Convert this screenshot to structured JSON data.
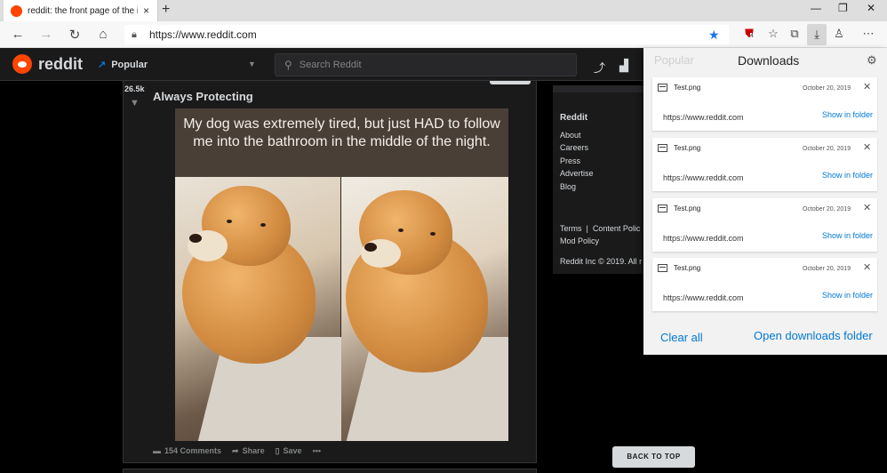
{
  "browser": {
    "tab_title": "reddit: the front page of the inte",
    "tab_close": "×",
    "new_tab": "+",
    "url": "https://www.reddit.com",
    "extension_badge": "4",
    "win_minimize": "—",
    "win_restore": "❐",
    "win_close": "✕"
  },
  "reddit": {
    "logo_text": "reddit",
    "feed_label": "Popular",
    "search_placeholder": "Search Reddit"
  },
  "post": {
    "votes": "26.5k",
    "title": "Always Protecting",
    "image_caption": "My dog was extremely tired, but just HAD to follow me into the bathroom in the middle of the night.",
    "comments": "154 Comments",
    "share": "Share",
    "save": "Save",
    "more": "•••"
  },
  "sidebar": {
    "title": "Reddit",
    "links": [
      "About",
      "Careers",
      "Press",
      "Advertise",
      "Blog"
    ],
    "footer_links": "Terms  |  Content Polic",
    "mod_policy": "Mod Policy",
    "copyright": "Reddit Inc © 2019. All r"
  },
  "back_to_top": "BACK TO TOP",
  "downloads": {
    "ghost_text": "Popular",
    "title": "Downloads",
    "items": [
      {
        "name": "Test.png",
        "date": "October 20, 2019",
        "url": "https://www.reddit.com",
        "action": "Show in folder"
      },
      {
        "name": "Test.png",
        "date": "October 20, 2019",
        "url": "https://www.reddit.com",
        "action": "Show in folder"
      },
      {
        "name": "Test.png",
        "date": "October 20, 2019",
        "url": "https://www.reddit.com",
        "action": "Show in folder"
      },
      {
        "name": "Test.png",
        "date": "October 20, 2019",
        "url": "https://www.reddit.com",
        "action": "Show in folder"
      }
    ],
    "clear_all": "Clear all",
    "open_folder": "Open downloads folder"
  }
}
